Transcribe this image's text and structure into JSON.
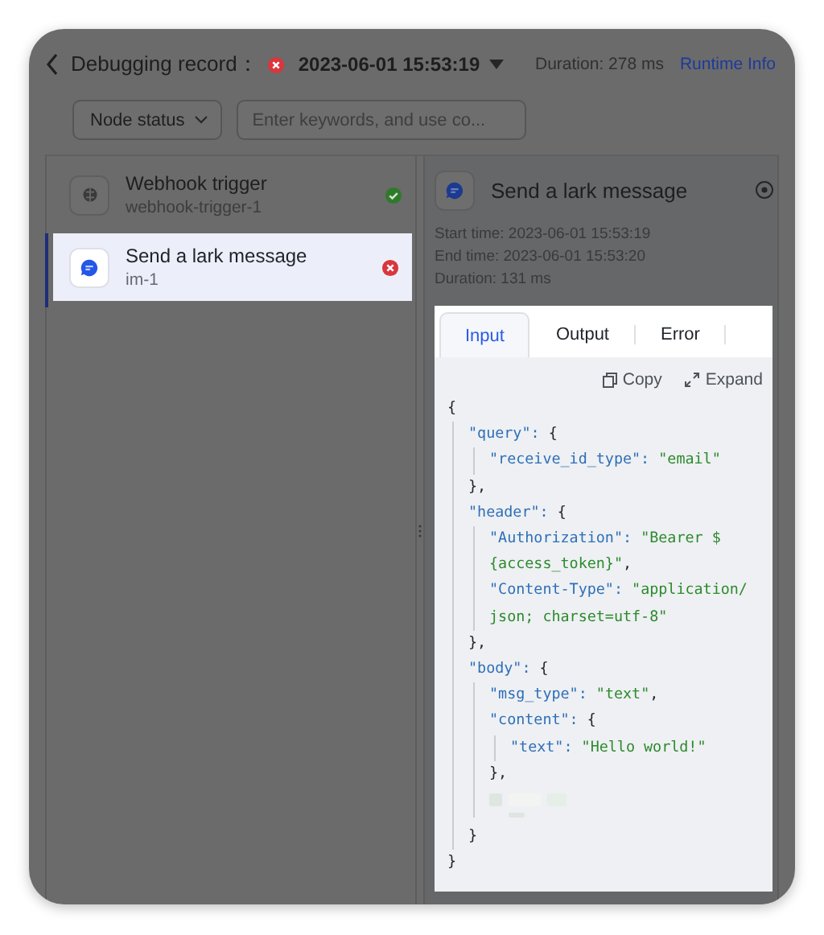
{
  "header": {
    "title": "Debugging record：",
    "failed": true,
    "record_time": "2023-06-01 15:53:19",
    "duration": "Duration: 278 ms",
    "link": "Runtime Info"
  },
  "filters": {
    "status_select": "Node status",
    "search": {
      "placeholder": "Enter keywords, and use co..."
    }
  },
  "nodes": [
    {
      "kind": "webhook",
      "name": "Webhook trigger",
      "id": "webhook-trigger-1",
      "failed": false,
      "selected": false
    },
    {
      "kind": "message",
      "name": "Send a lark message",
      "id": "im-1",
      "failed": true,
      "selected": true
    }
  ],
  "detail": {
    "title": "Send a lark message",
    "times": [
      "Start time: 2023-06-01 15:53:19",
      "End time: 2023-06-01 15:53:20",
      "Duration: 131 ms"
    ],
    "tabs": [
      {
        "label": "Input",
        "selected": true
      },
      {
        "label": "Output",
        "selected": false
      },
      {
        "label": "Error",
        "selected": false
      }
    ],
    "actions": [
      "Copy",
      "Expand"
    ],
    "code": {
      "open": "{",
      "close": "}",
      "children": [
        {
          "key": "\"query\":",
          "open": "{",
          "close": "},",
          "children": [
            {
              "key": "\"receive_id_type\":",
              "value": [
                "\"email\""
              ]
            }
          ]
        },
        {
          "key": "\"header\":",
          "open": "{",
          "close": "},",
          "children": [
            {
              "key": "\"Authorization\":",
              "value": [
                "\"Bearer $",
                "{access_token}\""
              ],
              "trail": ","
            },
            {
              "key": "\"Content-Type\":",
              "value": [
                "\"application/",
                "json; charset=utf-8\""
              ]
            }
          ]
        },
        {
          "key": "\"body\":",
          "open": "{",
          "close": "}",
          "children": [
            {
              "key": "\"msg_type\":",
              "value": [
                "\"text\""
              ],
              "trail": ","
            },
            {
              "key": "\"content\":",
              "open": "{",
              "close": "},",
              "children": [
                {
                  "key": "\"text\":",
                  "value": [
                    "\"Hello world!\""
                  ]
                }
              ]
            },
            {
              "kind": "redacted"
            },
            {
              "kind": "redacted_short"
            }
          ]
        }
      ]
    }
  }
}
